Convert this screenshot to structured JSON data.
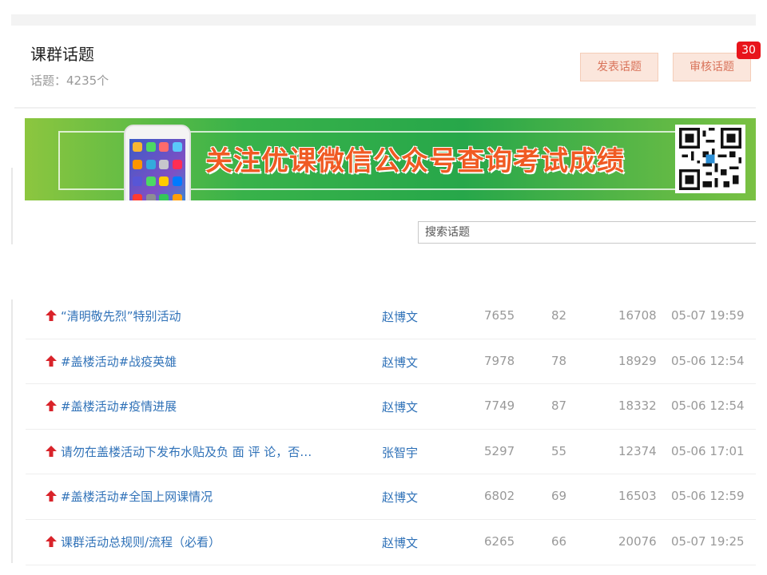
{
  "header": {
    "title": "课群话题",
    "count_text": "话题：4235个",
    "post_button": "发表话题",
    "review_button": "审核话题",
    "review_badge": "30"
  },
  "banner": {
    "text": "关注优课微信公众号查询考试成绩"
  },
  "search": {
    "placeholder": "搜索话题"
  },
  "topics": [
    {
      "title": "“清明敬先烈”特别活动",
      "author": "赵博文",
      "col1": "7655",
      "col2": "82",
      "col3": "16708",
      "time": "05-07 19:59"
    },
    {
      "title": "#盖楼活动#战疫英雄",
      "author": "赵博文",
      "col1": "7978",
      "col2": "78",
      "col3": "18929",
      "time": "05-06 12:54"
    },
    {
      "title": "#盖楼活动#疫情进展",
      "author": "赵博文",
      "col1": "7749",
      "col2": "87",
      "col3": "18332",
      "time": "05-06 12:54"
    },
    {
      "title": "请勿在盖楼活动下发布水贴及负 面 评 论，否…",
      "author": "张智宇",
      "col1": "5297",
      "col2": "55",
      "col3": "12374",
      "time": "05-06 17:01"
    },
    {
      "title": "#盖楼活动#全国上网课情况",
      "author": "赵博文",
      "col1": "6802",
      "col2": "69",
      "col3": "16503",
      "time": "05-06 12:59"
    },
    {
      "title": "课群活动总规则/流程（必看）",
      "author": "赵博文",
      "col1": "6265",
      "col2": "66",
      "col3": "20076",
      "time": "05-07 19:25"
    }
  ],
  "colors": {
    "link": "#3072b8",
    "pin_arrow": "#d9232a",
    "button_bg": "#fbe6dc",
    "badge": "#e8141b"
  }
}
